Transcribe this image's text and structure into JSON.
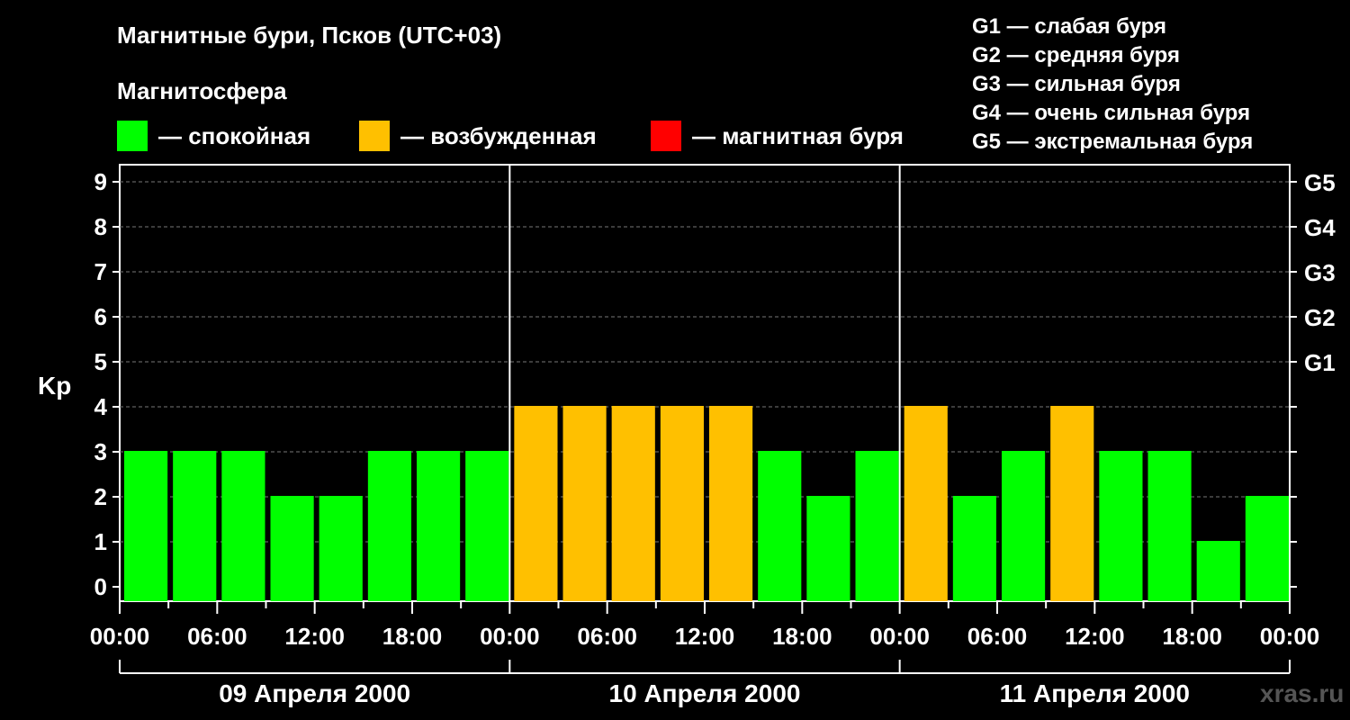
{
  "chart_data": {
    "type": "bar",
    "title": "Магнитные бури, Псков (UTC+03)",
    "subtitle": "Магнитосфера",
    "ylabel": "Kp",
    "ylim": [
      0,
      9
    ],
    "yticks": [
      "0",
      "1",
      "2",
      "3",
      "4",
      "5",
      "6",
      "7",
      "8",
      "9"
    ],
    "g_levels": [
      {
        "label": "G1",
        "kp": 5
      },
      {
        "label": "G2",
        "kp": 6
      },
      {
        "label": "G3",
        "kp": 7
      },
      {
        "label": "G4",
        "kp": 8
      },
      {
        "label": "G5",
        "kp": 9
      }
    ],
    "x_ticks": [
      "00:00",
      "06:00",
      "12:00",
      "18:00",
      "00:00",
      "06:00",
      "12:00",
      "18:00",
      "00:00",
      "06:00",
      "12:00",
      "18:00",
      "00:00"
    ],
    "days": [
      "09 Апреля 2000",
      "10 Апреля 2000",
      "11 Апреля 2000"
    ],
    "values": [
      3,
      3,
      3,
      2,
      2,
      3,
      3,
      3,
      4,
      4,
      4,
      4,
      4,
      3,
      2,
      3,
      4,
      2,
      3,
      4,
      3,
      3,
      1,
      2
    ],
    "colors": {
      "quiet": "#00ff00",
      "excited": "#ffc000",
      "storm": "#ff0000"
    },
    "legend": [
      {
        "label": "— спокойная",
        "color": "#00ff00"
      },
      {
        "label": "— возбужденная",
        "color": "#ffc000"
      },
      {
        "label": "— магнитная буря",
        "color": "#ff0000"
      }
    ],
    "storm_legend": [
      "G1 — слабая буря",
      "G2 — средняя буря",
      "G3 — сильная буря",
      "G4 — очень сильная буря",
      "G5 — экстремальная буря"
    ],
    "watermark": "xras.ru"
  }
}
